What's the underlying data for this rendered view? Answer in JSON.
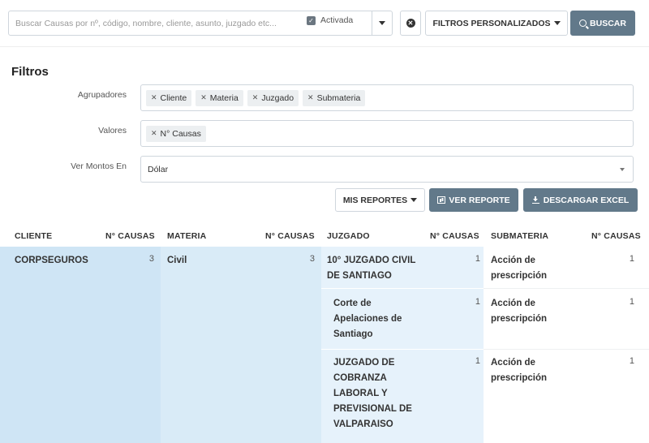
{
  "search": {
    "placeholder": "Buscar Causas por nº, código, nombre, cliente, asunto, juzgado etc...",
    "activada_label": "Activada",
    "filtros_label": "FILTROS PERSONALIZADOS",
    "buscar_label": "BUSCAR"
  },
  "filters": {
    "title": "Filtros",
    "agrupadores_label": "Agrupadores",
    "agrupadores": [
      "Cliente",
      "Materia",
      "Juzgado",
      "Submateria"
    ],
    "valores_label": "Valores",
    "valores": [
      "N° Causas"
    ],
    "montos_label": "Ver Montos En",
    "montos_value": "Dólar"
  },
  "actions": {
    "mis_reportes": "MIS REPORTES",
    "ver_reporte": "VER REPORTE",
    "descargar_excel": "DESCARGAR EXCEL"
  },
  "table": {
    "headers": {
      "cliente": "CLIENTE",
      "n1": "N° CAUSAS",
      "materia": "MATERIA",
      "n2": "N° CAUSAS",
      "juzgado": "JUZGADO",
      "n3": "N° CAUSAS",
      "submateria": "SUBMATERIA",
      "n4": "N° CAUSAS"
    },
    "cliente": {
      "name": "CORPSEGUROS",
      "count": "3"
    },
    "materia": {
      "name": "Civil",
      "count": "3"
    },
    "juzgados": [
      {
        "lines": [
          "10° JUZGADO CIVIL",
          "DE SANTIAGO"
        ],
        "count": "1",
        "sub_lines": [
          "Acción de",
          "prescripción"
        ],
        "sub_count": "1"
      },
      {
        "lines": [
          "Corte de",
          "Apelaciones de",
          "Santiago"
        ],
        "count": "1",
        "sub_lines": [
          "Acción de",
          "prescripción"
        ],
        "sub_count": "1"
      },
      {
        "lines": [
          "JUZGADO DE",
          "COBRANZA",
          "LABORAL Y",
          "PREVISIONAL DE",
          "VALPARAISO"
        ],
        "count": "1",
        "sub_lines": [
          "Acción de",
          "prescripción"
        ],
        "sub_count": "1"
      }
    ]
  }
}
